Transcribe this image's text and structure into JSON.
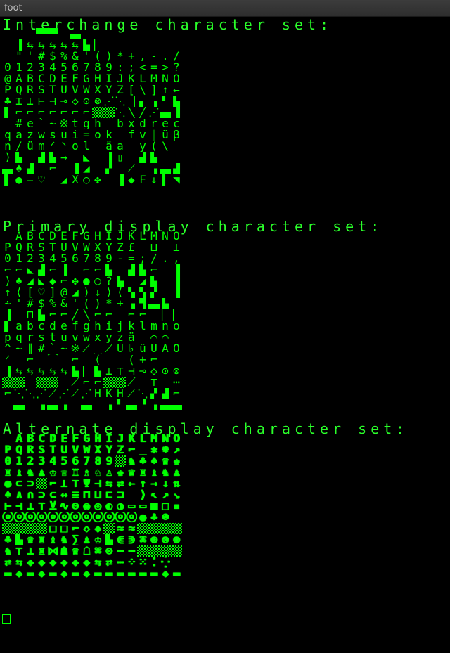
{
  "window": {
    "title": "foot"
  },
  "terminal": {
    "accent_color": "#00ff00",
    "sections": [
      {
        "heading": "Interchange character set:",
        "rows": [
          "   ▀▀ ▄      ",
          " ▐⇆⇆⇆⇆⇆▙▏    ",
          " \"'#$%&'()*+,-./",
          "0123456789:;<=>?",
          "@ABCDEFGHIJKLMNO",
          "PQRSTUVWXYZ[\\]↑←",
          "♣⌶⊥⊢⊣⊸◇⊙⊗⋰⋱▕▖▗▘▙",
          "▌⌐⌐⌐⌐⌐⌐⌐▓▒⋱╲╱⋰▄▐",
          "_#e`~※tgh bxdrec",
          "qazwsui=ok fv∥üβj",
          "n/ümᐟᐠol äa y(\\",
          "⟩▙ ▟▙→ ◣ ▐▯ ▟▙",
          "▄♠▟ ⌐ ▐◢ ▞ ⟋ ▗▄▟",
          "▌●⎯♡ ◢X○✤ ▐◆F↓▌◥▌"
        ]
      },
      {
        "heading": "Primary display character set:",
        "rows": [
          " ABCDEFGHIJKLMNO",
          "PQRSTUVWXYZ£ ⊔ ⊥",
          "0123456789-=;/.,",
          "⌐⌐◣▟⌐▐ ⌐⌐▙ ▟▙⌐ ▐",
          "⟩♠◢◣◆⌐✤●○?▙ ◢▙ ▐",
          "↑⟨[♡]@◢⟩↓⟩⟨▚▚▞ ▐",
          "⩪'#$%&'()*+▗▜▄▙",
          "▐ ⊓▙⌐⌐╱╲⌐⌐ ⌐⌐ ▏▏",
          "▌abcdefghijklmno",
          "pqrstuvwxyzä ⌒⌒",
          "^~∥#`~※⟋‿⟋Ü♭üÜÄÖ",
          "ᐟ ⌐ ⁀ ⌐ ⟨  (+⌐",
          "▐⇆⇆⇆⇆⇆▙▏▙⊥⊤⊣⊸◇⊙⊗",
          "▓▒ ▓▒ ⟋⌐⌐▒▓⟋ ⊤ ⋯",
          "⌐⋱⋱⋰⟋⋰⟋⋰HKH⟋⋱▞▟⌐",
          " ▄ ▗▄▗ ▄ ▗▘▄▝▗▄▄▄▄"
        ]
      },
      {
        "heading": "Alternate display character set:",
        "rows": [
          " ABCDEFGHIJKLMNO",
          "PQRSTUVWXYZ⌐▁✱⁕↗",
          "0123456789▓♞♣♠♛♚",
          "♜♝♞♟♔♕♖♗♘♙♚♛♜♝♞♟",
          "●⊂⊃▓⌐⊥⊤Ψ⊣⇆⇄←↑→↓⇅",
          "♠∧∩⊃⊂↔≡⊓⊔⊏⊐ ⟩↖↗↘",
          "⊢⊣⊥⊤⊻∿⊖◉◎◐◑▭▭■□▪",
          "ⓞⓞⓞⓞⓞⓞⓞⓞⓞⓞⓞⓞ●♣☻",
          "▒▒▓▓□□⌐◇◆▓≈≈▒▓▒▓",
          "♣▙♛♜♝♞∑♟♔▙⋐⋑⌘⊕⊗⊛",
          "♞⊤⊥♜⋈☗♛☖⌘⊗⋯⋯▓▒▓▒",
          "⇄⇆◆◆◆◆◆◆⇆⇄⋯⁘⁙⁚⁛ ⋮",
          "▬◆▬◆▬◆▬◆▬▬▬▬▬▬◆▬"
        ]
      }
    ]
  }
}
